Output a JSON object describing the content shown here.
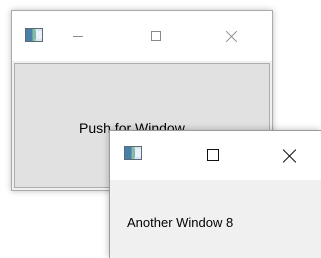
{
  "main_window": {
    "title": "",
    "icon": "app-icon",
    "controls": {
      "minimize": "minimize-icon",
      "maximize": "maximize-icon",
      "close": "close-icon"
    },
    "push_button_label": "Push for Window"
  },
  "second_window": {
    "title": "",
    "icon": "app-icon",
    "controls": {
      "maximize": "maximize-icon",
      "close": "close-icon"
    },
    "label_text": "Another Window  8"
  }
}
